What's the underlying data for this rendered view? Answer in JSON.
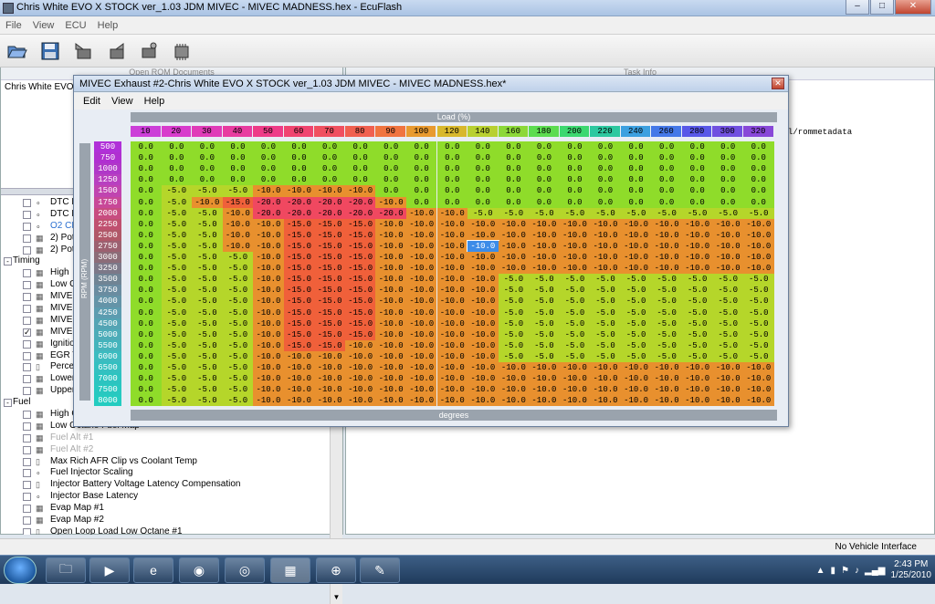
{
  "app": {
    "title": "Chris White EVO X STOCK ver_1.03 JDM MIVEC - MIVEC MADNESS.hex - EcuFlash"
  },
  "menu": {
    "items": [
      "File",
      "View",
      "ECU",
      "Help"
    ]
  },
  "left_pane": {
    "header": "Open ROM Documents",
    "rom_name": "Chris White EVO X"
  },
  "right_pane": {
    "header": "Task Info",
    "path_text": "l/rommetadata"
  },
  "tree": [
    {
      "type": "node",
      "icon": "scalar",
      "label": "DTC P",
      "checked": false
    },
    {
      "type": "node",
      "icon": "scalar",
      "label": "DTC P",
      "checked": false
    },
    {
      "type": "node",
      "icon": "scalar",
      "label": "O2 CE",
      "checked": false,
      "blue": true
    },
    {
      "type": "node",
      "icon": "table",
      "label": "2) Pot",
      "checked": false
    },
    {
      "type": "node",
      "icon": "table",
      "label": "2) Pot",
      "checked": false
    },
    {
      "type": "group",
      "label": "Timing",
      "expanded": "-"
    },
    {
      "type": "node",
      "icon": "table",
      "label": "High",
      "checked": false
    },
    {
      "type": "node",
      "icon": "table",
      "label": "Low C",
      "checked": false
    },
    {
      "type": "node",
      "icon": "table",
      "label": "MIVEC",
      "checked": false
    },
    {
      "type": "node",
      "icon": "table",
      "label": "MIVEC",
      "checked": false
    },
    {
      "type": "node",
      "icon": "table",
      "label": "MIVEC",
      "checked": false
    },
    {
      "type": "node",
      "icon": "table",
      "label": "MIVEC",
      "checked": true
    },
    {
      "type": "node",
      "icon": "table",
      "label": "Ignitio",
      "checked": false
    },
    {
      "type": "node",
      "icon": "table",
      "label": "EGR T",
      "checked": false
    },
    {
      "type": "node",
      "icon": "axis",
      "label": "Percen",
      "checked": false
    },
    {
      "type": "node",
      "icon": "table",
      "label": "Lower",
      "checked": false
    },
    {
      "type": "node",
      "icon": "table",
      "label": "Upper",
      "checked": false
    },
    {
      "type": "group",
      "label": "Fuel",
      "expanded": "-"
    },
    {
      "type": "node",
      "icon": "table",
      "label": "High O",
      "checked": false
    },
    {
      "type": "node",
      "icon": "table",
      "label": "Low Octane Fuel Map",
      "checked": false
    },
    {
      "type": "node",
      "icon": "table",
      "label": "Fuel Alt #1",
      "checked": false,
      "faded": true
    },
    {
      "type": "node",
      "icon": "table",
      "label": "Fuel Alt #2",
      "checked": false,
      "faded": true
    },
    {
      "type": "node",
      "icon": "axis",
      "label": "Max Rich AFR Clip vs Coolant Temp",
      "checked": false
    },
    {
      "type": "node",
      "icon": "scalar",
      "label": "Fuel Injector Scaling",
      "checked": false
    },
    {
      "type": "node",
      "icon": "axis",
      "label": "Injector Battery Voltage Latency Compensation",
      "checked": false
    },
    {
      "type": "node",
      "icon": "scalar",
      "label": "Injector Base Latency",
      "checked": false
    },
    {
      "type": "node",
      "icon": "table",
      "label": "Evap Map #1",
      "checked": false
    },
    {
      "type": "node",
      "icon": "table",
      "label": "Evap Map #2",
      "checked": false
    },
    {
      "type": "node",
      "icon": "axis",
      "label": "Open Loop Load Low Octane #1",
      "checked": false
    }
  ],
  "map_window": {
    "title": "MIVEC Exhaust #2-Chris White EVO X STOCK ver_1.03 JDM MIVEC - MIVEC MADNESS.hex*",
    "menu": [
      "Edit",
      "View",
      "Help"
    ],
    "x_axis_label": "Load (%)",
    "y_axis_label": "RPM (RPM)",
    "z_label": "degrees",
    "load": [
      "10",
      "20",
      "30",
      "40",
      "50",
      "60",
      "70",
      "80",
      "90",
      "100",
      "120",
      "140",
      "160",
      "180",
      "200",
      "220",
      "240",
      "260",
      "280",
      "300",
      "320"
    ],
    "rpm": [
      "500",
      "750",
      "1000",
      "1250",
      "1500",
      "1750",
      "2000",
      "2250",
      "2500",
      "2750",
      "3000",
      "3250",
      "3500",
      "3750",
      "4000",
      "4250",
      "4500",
      "5000",
      "5500",
      "6000",
      "6500",
      "7000",
      "7500",
      "8000"
    ],
    "selected": {
      "row": 9,
      "col": 11
    },
    "values": [
      [
        "0.0",
        "0.0",
        "0.0",
        "0.0",
        "0.0",
        "0.0",
        "0.0",
        "0.0",
        "0.0",
        "0.0",
        "0.0",
        "0.0",
        "0.0",
        "0.0",
        "0.0",
        "0.0",
        "0.0",
        "0.0",
        "0.0",
        "0.0",
        "0.0"
      ],
      [
        "0.0",
        "0.0",
        "0.0",
        "0.0",
        "0.0",
        "0.0",
        "0.0",
        "0.0",
        "0.0",
        "0.0",
        "0.0",
        "0.0",
        "0.0",
        "0.0",
        "0.0",
        "0.0",
        "0.0",
        "0.0",
        "0.0",
        "0.0",
        "0.0"
      ],
      [
        "0.0",
        "0.0",
        "0.0",
        "0.0",
        "0.0",
        "0.0",
        "0.0",
        "0.0",
        "0.0",
        "0.0",
        "0.0",
        "0.0",
        "0.0",
        "0.0",
        "0.0",
        "0.0",
        "0.0",
        "0.0",
        "0.0",
        "0.0",
        "0.0"
      ],
      [
        "0.0",
        "0.0",
        "0.0",
        "0.0",
        "0.0",
        "0.0",
        "0.0",
        "0.0",
        "0.0",
        "0.0",
        "0.0",
        "0.0",
        "0.0",
        "0.0",
        "0.0",
        "0.0",
        "0.0",
        "0.0",
        "0.0",
        "0.0",
        "0.0"
      ],
      [
        "0.0",
        "-5.0",
        "-5.0",
        "-5.0",
        "-10.0",
        "-10.0",
        "-10.0",
        "-10.0",
        "0.0",
        "0.0",
        "0.0",
        "0.0",
        "0.0",
        "0.0",
        "0.0",
        "0.0",
        "0.0",
        "0.0",
        "0.0",
        "0.0",
        "0.0"
      ],
      [
        "0.0",
        "-5.0",
        "-10.0",
        "-15.0",
        "-20.0",
        "-20.0",
        "-20.0",
        "-20.0",
        "-10.0",
        "0.0",
        "0.0",
        "0.0",
        "0.0",
        "0.0",
        "0.0",
        "0.0",
        "0.0",
        "0.0",
        "0.0",
        "0.0",
        "0.0"
      ],
      [
        "0.0",
        "-5.0",
        "-5.0",
        "-10.0",
        "-20.0",
        "-20.0",
        "-20.0",
        "-20.0",
        "-20.0",
        "-10.0",
        "-10.0",
        "-5.0",
        "-5.0",
        "-5.0",
        "-5.0",
        "-5.0",
        "-5.0",
        "-5.0",
        "-5.0",
        "-5.0",
        "-5.0"
      ],
      [
        "0.0",
        "-5.0",
        "-5.0",
        "-10.0",
        "-10.0",
        "-15.0",
        "-15.0",
        "-15.0",
        "-10.0",
        "-10.0",
        "-10.0",
        "-10.0",
        "-10.0",
        "-10.0",
        "-10.0",
        "-10.0",
        "-10.0",
        "-10.0",
        "-10.0",
        "-10.0",
        "-10.0"
      ],
      [
        "0.0",
        "-5.0",
        "-5.0",
        "-10.0",
        "-10.0",
        "-15.0",
        "-15.0",
        "-15.0",
        "-10.0",
        "-10.0",
        "-10.0",
        "-10.0",
        "-10.0",
        "-10.0",
        "-10.0",
        "-10.0",
        "-10.0",
        "-10.0",
        "-10.0",
        "-10.0",
        "-10.0"
      ],
      [
        "0.0",
        "-5.0",
        "-5.0",
        "-10.0",
        "-10.0",
        "-15.0",
        "-15.0",
        "-15.0",
        "-10.0",
        "-10.0",
        "-10.0",
        "-10.0",
        "-10.0",
        "-10.0",
        "-10.0",
        "-10.0",
        "-10.0",
        "-10.0",
        "-10.0",
        "-10.0",
        "-10.0"
      ],
      [
        "0.0",
        "-5.0",
        "-5.0",
        "-5.0",
        "-10.0",
        "-15.0",
        "-15.0",
        "-15.0",
        "-10.0",
        "-10.0",
        "-10.0",
        "-10.0",
        "-10.0",
        "-10.0",
        "-10.0",
        "-10.0",
        "-10.0",
        "-10.0",
        "-10.0",
        "-10.0",
        "-10.0"
      ],
      [
        "0.0",
        "-5.0",
        "-5.0",
        "-5.0",
        "-10.0",
        "-15.0",
        "-15.0",
        "-15.0",
        "-10.0",
        "-10.0",
        "-10.0",
        "-10.0",
        "-10.0",
        "-10.0",
        "-10.0",
        "-10.0",
        "-10.0",
        "-10.0",
        "-10.0",
        "-10.0",
        "-10.0"
      ],
      [
        "0.0",
        "-5.0",
        "-5.0",
        "-5.0",
        "-10.0",
        "-15.0",
        "-15.0",
        "-15.0",
        "-10.0",
        "-10.0",
        "-10.0",
        "-10.0",
        "-5.0",
        "-5.0",
        "-5.0",
        "-5.0",
        "-5.0",
        "-5.0",
        "-5.0",
        "-5.0",
        "-5.0"
      ],
      [
        "0.0",
        "-5.0",
        "-5.0",
        "-5.0",
        "-10.0",
        "-15.0",
        "-15.0",
        "-15.0",
        "-10.0",
        "-10.0",
        "-10.0",
        "-10.0",
        "-5.0",
        "-5.0",
        "-5.0",
        "-5.0",
        "-5.0",
        "-5.0",
        "-5.0",
        "-5.0",
        "-5.0"
      ],
      [
        "0.0",
        "-5.0",
        "-5.0",
        "-5.0",
        "-10.0",
        "-15.0",
        "-15.0",
        "-15.0",
        "-10.0",
        "-10.0",
        "-10.0",
        "-10.0",
        "-5.0",
        "-5.0",
        "-5.0",
        "-5.0",
        "-5.0",
        "-5.0",
        "-5.0",
        "-5.0",
        "-5.0"
      ],
      [
        "0.0",
        "-5.0",
        "-5.0",
        "-5.0",
        "-10.0",
        "-15.0",
        "-15.0",
        "-15.0",
        "-10.0",
        "-10.0",
        "-10.0",
        "-10.0",
        "-5.0",
        "-5.0",
        "-5.0",
        "-5.0",
        "-5.0",
        "-5.0",
        "-5.0",
        "-5.0",
        "-5.0"
      ],
      [
        "0.0",
        "-5.0",
        "-5.0",
        "-5.0",
        "-10.0",
        "-15.0",
        "-15.0",
        "-15.0",
        "-10.0",
        "-10.0",
        "-10.0",
        "-10.0",
        "-5.0",
        "-5.0",
        "-5.0",
        "-5.0",
        "-5.0",
        "-5.0",
        "-5.0",
        "-5.0",
        "-5.0"
      ],
      [
        "0.0",
        "-5.0",
        "-5.0",
        "-5.0",
        "-10.0",
        "-15.0",
        "-15.0",
        "-15.0",
        "-10.0",
        "-10.0",
        "-10.0",
        "-10.0",
        "-5.0",
        "-5.0",
        "-5.0",
        "-5.0",
        "-5.0",
        "-5.0",
        "-5.0",
        "-5.0",
        "-5.0"
      ],
      [
        "0.0",
        "-5.0",
        "-5.0",
        "-5.0",
        "-10.0",
        "-15.0",
        "-15.0",
        "-10.0",
        "-10.0",
        "-10.0",
        "-10.0",
        "-10.0",
        "-5.0",
        "-5.0",
        "-5.0",
        "-5.0",
        "-5.0",
        "-5.0",
        "-5.0",
        "-5.0",
        "-5.0"
      ],
      [
        "0.0",
        "-5.0",
        "-5.0",
        "-5.0",
        "-10.0",
        "-10.0",
        "-10.0",
        "-10.0",
        "-10.0",
        "-10.0",
        "-10.0",
        "-10.0",
        "-5.0",
        "-5.0",
        "-5.0",
        "-5.0",
        "-5.0",
        "-5.0",
        "-5.0",
        "-5.0",
        "-5.0"
      ],
      [
        "0.0",
        "-5.0",
        "-5.0",
        "-5.0",
        "-10.0",
        "-10.0",
        "-10.0",
        "-10.0",
        "-10.0",
        "-10.0",
        "-10.0",
        "-10.0",
        "-10.0",
        "-10.0",
        "-10.0",
        "-10.0",
        "-10.0",
        "-10.0",
        "-10.0",
        "-10.0",
        "-10.0"
      ],
      [
        "0.0",
        "-5.0",
        "-5.0",
        "-5.0",
        "-10.0",
        "-10.0",
        "-10.0",
        "-10.0",
        "-10.0",
        "-10.0",
        "-10.0",
        "-10.0",
        "-10.0",
        "-10.0",
        "-10.0",
        "-10.0",
        "-10.0",
        "-10.0",
        "-10.0",
        "-10.0",
        "-10.0"
      ],
      [
        "0.0",
        "-5.0",
        "-5.0",
        "-5.0",
        "-10.0",
        "-10.0",
        "-10.0",
        "-10.0",
        "-10.0",
        "-10.0",
        "-10.0",
        "-10.0",
        "-10.0",
        "-10.0",
        "-10.0",
        "-10.0",
        "-10.0",
        "-10.0",
        "-10.0",
        "-10.0",
        "-10.0"
      ],
      [
        "0.0",
        "-5.0",
        "-5.0",
        "-5.0",
        "-10.0",
        "-10.0",
        "-10.0",
        "-10.0",
        "-10.0",
        "-10.0",
        "-10.0",
        "-10.0",
        "-10.0",
        "-10.0",
        "-10.0",
        "-10.0",
        "-10.0",
        "-10.0",
        "-10.0",
        "-10.0",
        "-10.0"
      ]
    ],
    "value_colors": {
      "0.0": "#8fdc2a",
      "-5.0": "#b5d62a",
      "-10.0": "#e8902e",
      "-15.0": "#f0603a",
      "-20.0": "#f04860"
    },
    "load_colors": [
      "#cc3fd8",
      "#d83ccc",
      "#e03cb8",
      "#e83ca0",
      "#ee3c88",
      "#f04470",
      "#f05060",
      "#f06050",
      "#f07440",
      "#e89a30",
      "#d8b82c",
      "#b8d030",
      "#8cd838",
      "#5cdc50",
      "#3cd870",
      "#2cc8a0",
      "#3ca0e0",
      "#4478e8",
      "#5858e8",
      "#7050e0",
      "#8848d8"
    ],
    "rpm_colors": [
      "#b030d8",
      "#b030d0",
      "#b038c8",
      "#b840c0",
      "#c044b0",
      "#c84898",
      "#c84c80",
      "#c05070",
      "#b05868",
      "#9c6070",
      "#8c6c78",
      "#7c7888",
      "#708494",
      "#6a8ca0",
      "#6494a8",
      "#5c9cb0",
      "#54a4b4",
      "#4cacb8",
      "#44b4bc",
      "#3cbcc0",
      "#34c0c0",
      "#2cc4c0",
      "#28c8c0",
      "#24ccc0"
    ]
  },
  "status": {
    "text": "No Vehicle Interface"
  },
  "taskbar": {
    "time": "2:43 PM",
    "date": "1/25/2010"
  }
}
